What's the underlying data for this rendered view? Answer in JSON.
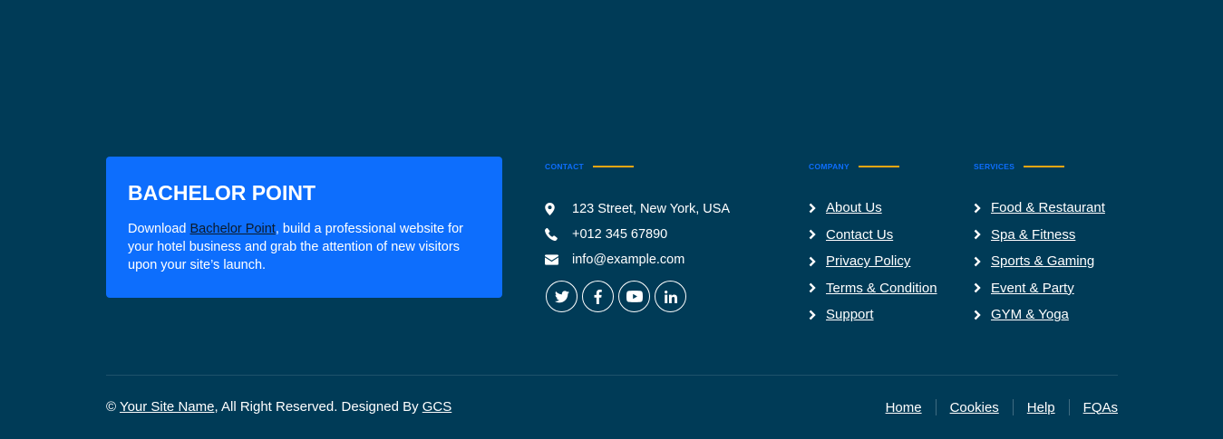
{
  "brand": {
    "title": "BACHELOR POINT",
    "desc_prefix": "Download ",
    "desc_link": "Bachelor Point",
    "desc_suffix": ", build a professional website for your hotel business and grab the attention of new visitors upon your site’s launch."
  },
  "contact": {
    "heading": "CONTACT",
    "address": "123 Street, New York, USA",
    "phone": "+012 345 67890",
    "email": "info@example.com",
    "icons": [
      "map-marker-icon",
      "phone-icon",
      "envelope-icon"
    ]
  },
  "social": {
    "icons": [
      "twitter-icon",
      "facebook-icon",
      "youtube-icon",
      "linkedin-icon"
    ]
  },
  "company": {
    "heading": "COMPANY",
    "links": [
      "About Us",
      "Contact Us",
      "Privacy Policy",
      "Terms & Condition",
      "Support"
    ]
  },
  "services": {
    "heading": "SERVICES",
    "links": [
      "Food & Restaurant",
      "Spa & Fitness",
      "Sports & Gaming",
      "Event & Party",
      "GYM & Yoga"
    ]
  },
  "footer": {
    "copy_symbol": "© ",
    "site_name": "Your Site Name",
    "rights": ", All Right Reserved. Designed By ",
    "designer": "GCS",
    "nav": [
      "Home",
      "Cookies",
      "Help",
      "FQAs"
    ]
  },
  "colors": {
    "background": "#003b57",
    "primary": "#0d6efd",
    "accent": "#f3a712",
    "text": "#ffffff"
  }
}
